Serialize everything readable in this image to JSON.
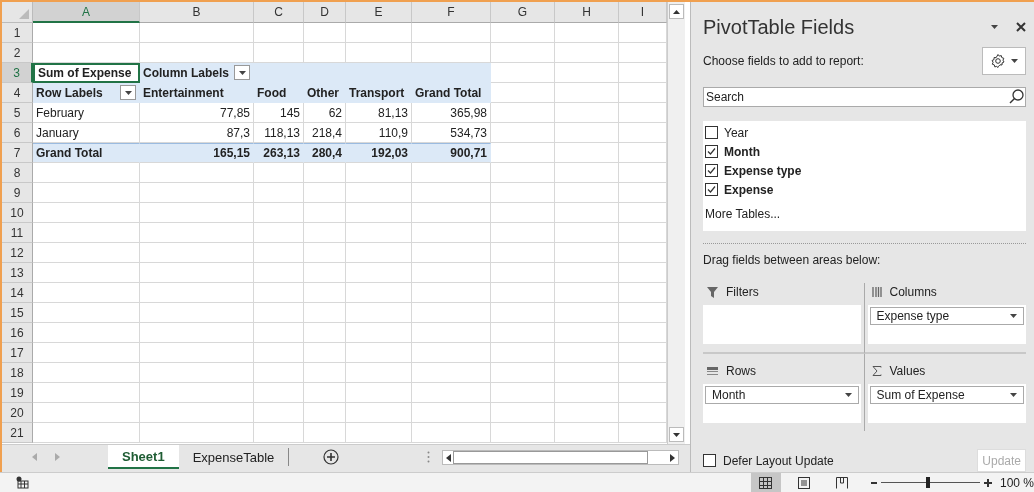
{
  "sheet": {
    "columns": [
      {
        "label": "A",
        "selected": true
      },
      {
        "label": "B",
        "selected": false
      },
      {
        "label": "C",
        "selected": false
      },
      {
        "label": "D",
        "selected": false
      },
      {
        "label": "E",
        "selected": false
      },
      {
        "label": "F",
        "selected": false
      },
      {
        "label": "G",
        "selected": false
      },
      {
        "label": "H",
        "selected": false
      },
      {
        "label": "I",
        "selected": false
      }
    ],
    "rows": [
      {
        "number": "1",
        "selected": false,
        "kind": "empty",
        "cells": []
      },
      {
        "number": "2",
        "selected": false,
        "kind": "empty",
        "cells": []
      },
      {
        "number": "3",
        "selected": true,
        "kind": "title",
        "cells": [
          {
            "text": "Sum of Expense",
            "selected": true
          },
          {
            "text": "Column Labels",
            "selected": false,
            "dropdown": true
          }
        ]
      },
      {
        "number": "4",
        "selected": false,
        "kind": "header",
        "cells": [
          {
            "text": "Row Labels",
            "selected": false,
            "dropdown": true
          },
          {
            "text": "Entertainment",
            "selected": false
          },
          {
            "text": "Food",
            "selected": false
          },
          {
            "text": "Other",
            "selected": false
          },
          {
            "text": "Transport",
            "selected": false
          },
          {
            "text": "Grand Total",
            "selected": false
          }
        ]
      },
      {
        "number": "5",
        "selected": false,
        "kind": "data",
        "cells": [
          {
            "text": "February",
            "selected": false
          },
          {
            "text": "77,85",
            "selected": false
          },
          {
            "text": "145",
            "selected": false
          },
          {
            "text": "62",
            "selected": false
          },
          {
            "text": "81,13",
            "selected": false
          },
          {
            "text": "365,98",
            "selected": false
          }
        ]
      },
      {
        "number": "6",
        "selected": false,
        "kind": "data",
        "cells": [
          {
            "text": "January",
            "selected": false
          },
          {
            "text": "87,3",
            "selected": false
          },
          {
            "text": "118,13",
            "selected": false
          },
          {
            "text": "218,4",
            "selected": false
          },
          {
            "text": "110,9",
            "selected": false
          },
          {
            "text": "534,73",
            "selected": false
          }
        ]
      },
      {
        "number": "7",
        "selected": false,
        "kind": "total",
        "cells": [
          {
            "text": "Grand Total",
            "selected": false
          },
          {
            "text": "165,15",
            "selected": false
          },
          {
            "text": "263,13",
            "selected": false
          },
          {
            "text": "280,4",
            "selected": false
          },
          {
            "text": "192,03",
            "selected": false
          },
          {
            "text": "900,71",
            "selected": false
          }
        ]
      },
      {
        "number": "8",
        "selected": false,
        "kind": "empty",
        "cells": []
      },
      {
        "number": "9",
        "selected": false,
        "kind": "empty",
        "cells": []
      },
      {
        "number": "10",
        "selected": false,
        "kind": "empty",
        "cells": []
      },
      {
        "number": "11",
        "selected": false,
        "kind": "empty",
        "cells": []
      },
      {
        "number": "12",
        "selected": false,
        "kind": "empty",
        "cells": []
      },
      {
        "number": "13",
        "selected": false,
        "kind": "empty",
        "cells": []
      },
      {
        "number": "14",
        "selected": false,
        "kind": "empty",
        "cells": []
      },
      {
        "number": "15",
        "selected": false,
        "kind": "empty",
        "cells": []
      },
      {
        "number": "16",
        "selected": false,
        "kind": "empty",
        "cells": []
      },
      {
        "number": "17",
        "selected": false,
        "kind": "empty",
        "cells": []
      },
      {
        "number": "18",
        "selected": false,
        "kind": "empty",
        "cells": []
      },
      {
        "number": "19",
        "selected": false,
        "kind": "empty",
        "cells": []
      },
      {
        "number": "20",
        "selected": false,
        "kind": "empty",
        "cells": []
      },
      {
        "number": "21",
        "selected": false,
        "kind": "empty",
        "cells": []
      }
    ],
    "tabs": [
      {
        "label": "Sheet1",
        "selected": true
      },
      {
        "label": "ExpenseTable",
        "selected": false
      }
    ]
  },
  "pane": {
    "title": "PivotTable Fields",
    "subtitle": "Choose fields to add to report:",
    "search": {
      "placeholder": "Search"
    },
    "fields": [
      {
        "label": "Year",
        "checked": false
      },
      {
        "label": "Month",
        "checked": true
      },
      {
        "label": "Expense type",
        "checked": true
      },
      {
        "label": "Expense",
        "checked": true
      }
    ],
    "more_tables": "More Tables...",
    "drag_hint": "Drag fields between areas below:",
    "areas": [
      {
        "kind": "filters",
        "label": "Filters"
      },
      {
        "kind": "columns",
        "label": "Columns",
        "items": [
          "Expense type"
        ]
      },
      {
        "kind": "rows",
        "label": "Rows",
        "items": [
          "Month"
        ]
      },
      {
        "kind": "values",
        "label": "Values",
        "items": [
          "Sum of Expense"
        ]
      }
    ],
    "defer": {
      "label": "Defer Layout Update",
      "checked": false
    },
    "update_button": {
      "label": "Update",
      "disabled": true
    }
  },
  "status_bar": {
    "views": [
      {
        "kind": "normal",
        "selected": true
      },
      {
        "kind": "page_layout",
        "selected": false
      },
      {
        "kind": "page_break",
        "selected": false
      }
    ],
    "zoom": {
      "level": 0.48,
      "reading": "100 %"
    }
  }
}
